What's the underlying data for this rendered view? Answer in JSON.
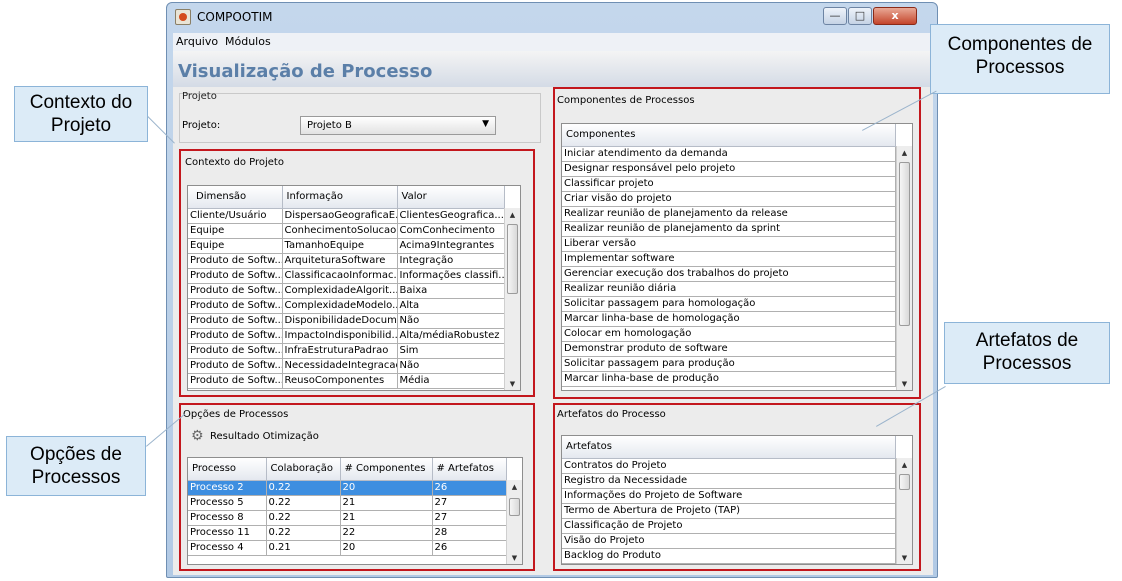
{
  "window": {
    "title": "COMPOOTIM",
    "min_label": "—",
    "max_label": "□",
    "close_label": "x"
  },
  "menu": [
    "Arquivo",
    "Módulos"
  ],
  "view_title": "Visualização de Processo",
  "projeto": {
    "group_title": "Projeto",
    "label": "Projeto:",
    "selected": "Projeto B"
  },
  "contexto": {
    "group_title": "Contexto do Projeto",
    "headers": [
      "Dimensão",
      "Informação",
      "Valor"
    ],
    "rows": [
      [
        "Cliente/Usuário",
        "DispersaoGeograficaE...",
        "ClientesGeografica..."
      ],
      [
        "Equipe",
        "ConhecimentoSolucao",
        "ComConhecimento"
      ],
      [
        "Equipe",
        "TamanhoEquipe",
        "Acima9Integrantes"
      ],
      [
        "Produto de Softw...",
        "ArquiteturaSoftware",
        "Integração"
      ],
      [
        "Produto de Softw...",
        "ClassificacaoInformac...",
        "Informações classifi..."
      ],
      [
        "Produto de Softw...",
        "ComplexidadeAlgorit...",
        "Baixa"
      ],
      [
        "Produto de Softw...",
        "ComplexidadeModelo...",
        "Alta"
      ],
      [
        "Produto de Softw...",
        "DisponibilidadeDocum...",
        "Não"
      ],
      [
        "Produto de Softw...",
        "ImpactoIndisponibilid...",
        "Alta/médiaRobustez"
      ],
      [
        "Produto de Softw...",
        "InfraEstruturaPadrao",
        "Sim"
      ],
      [
        "Produto de Softw...",
        "NecessidadeIntegracao",
        "Não"
      ],
      [
        "Produto de Softw...",
        "ReusoComponentes",
        "Média"
      ]
    ]
  },
  "opcoes": {
    "group_title": "Opções de Processos",
    "button_label": "Resultado Otimização",
    "headers": [
      "Processo",
      "Colaboração",
      "# Componentes",
      "# Artefatos"
    ],
    "rows": [
      [
        "Processo 2",
        "0.22",
        "20",
        "26"
      ],
      [
        "Processo 5",
        "0.22",
        "21",
        "27"
      ],
      [
        "Processo 8",
        "0.22",
        "21",
        "27"
      ],
      [
        "Processo 11",
        "0.22",
        "22",
        "28"
      ],
      [
        "Processo 4",
        "0.21",
        "20",
        "26"
      ]
    ]
  },
  "componentes": {
    "group_title": "Componentes de Processos",
    "header": "Componentes",
    "items": [
      "Iniciar atendimento da demanda",
      "Designar responsável pelo projeto",
      "Classificar projeto",
      "Criar visão do projeto",
      "Realizar reunião de planejamento da release",
      "Realizar reunião de planejamento da sprint",
      "Liberar versão",
      "Implementar software",
      "Gerenciar execução dos trabalhos do projeto",
      "Realizar reunião diária",
      "Solicitar passagem para homologação",
      "Marcar linha-base de homologação",
      "Colocar em homologação",
      "Demonstrar produto de software",
      "Solicitar passagem para produção",
      "Marcar linha-base de produção"
    ]
  },
  "artefatos": {
    "group_title": "Artefatos do Processo",
    "header": "Artefatos",
    "items": [
      "Contratos do Projeto",
      "Registro da Necessidade",
      "Informações do Projeto de Software",
      "Termo de Abertura de Projeto (TAP)",
      "Classificação de Projeto",
      "Visão do Projeto",
      "Backlog do Produto"
    ]
  },
  "callouts": {
    "contexto": "Contexto do Projeto",
    "componentes": "Componentes de Processos",
    "opcoes": "Opções de Processos",
    "artefatos": "Artefatos de Processos"
  },
  "colors": {
    "highlight_box": "#c3171d",
    "selection": "#3d8ee0",
    "callout_bg": "#dcebf7",
    "view_title": "#5b7fa8"
  },
  "icons": {
    "app": "app-icon",
    "gear": "gear-icon",
    "dropdown": "chevron-down-icon"
  }
}
